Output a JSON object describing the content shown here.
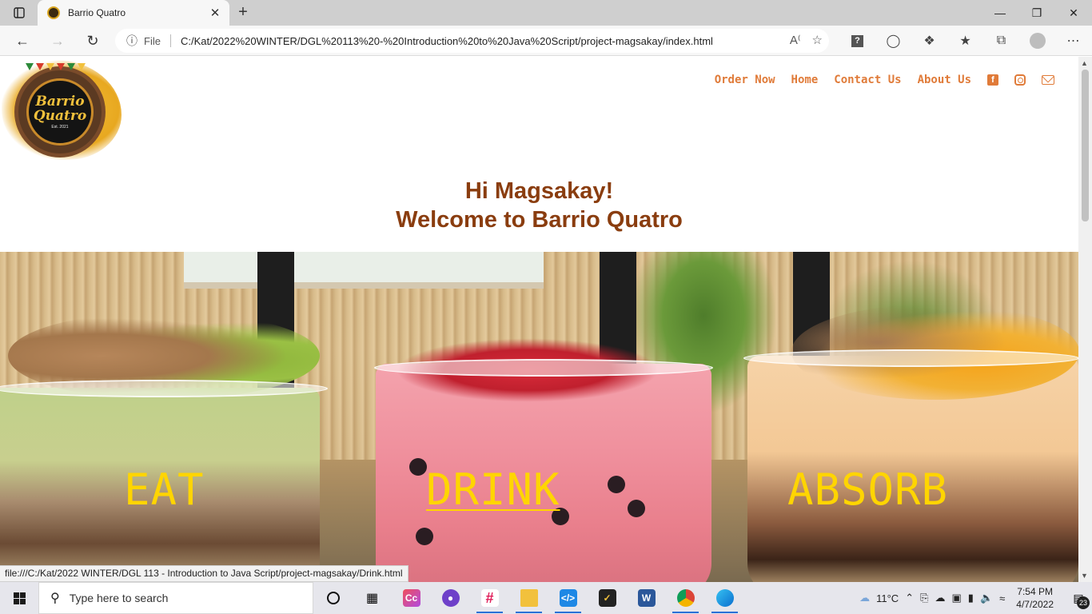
{
  "browser": {
    "tab_title": "Barrio Quatro",
    "tab_close": "✕",
    "new_tab": "+",
    "file_label": "File",
    "url": "C:/Kat/2022%20WINTER/DGL%20113%20-%20Introduction%20to%20Java%20Script/project-magsakay/index.html",
    "status_url": "file:///C:/Kat/2022 WINTER/DGL 113 - Introduction to Java Script/project-magsakay/Drink.html"
  },
  "logo": {
    "line1": "Barrio",
    "line2": "Quatro",
    "est": "Est. 2021"
  },
  "nav": {
    "items": [
      "Order Now",
      "Home",
      "Contact Us",
      "About Us"
    ],
    "icons": [
      "facebook-icon",
      "instagram-icon",
      "envelope-icon"
    ]
  },
  "hero": {
    "greeting": "Hi Magsakay!",
    "welcome": "Welcome to Barrio Quatro",
    "words": [
      "EAT",
      "DRINK",
      "ABSORB"
    ]
  },
  "taskbar": {
    "search_placeholder": "Type here to search",
    "temperature": "11°C",
    "time": "7:54 PM",
    "date": "4/7/2022",
    "notification_count": "23"
  },
  "colors": {
    "nav_accent": "#e07b39",
    "heading": "#8a3d0f",
    "hero_word": "#ffd500"
  }
}
